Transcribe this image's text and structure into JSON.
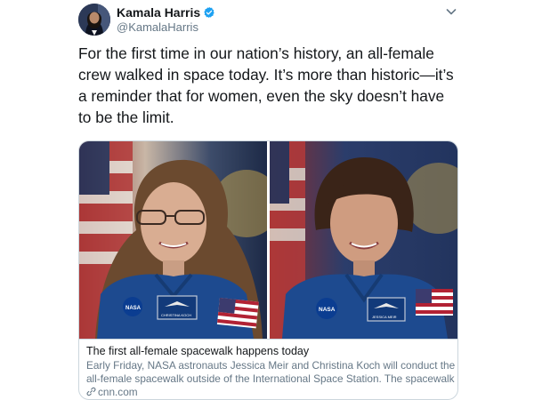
{
  "author": {
    "name": "Kamala Harris",
    "handle": "@KamalaHarris",
    "verified": true
  },
  "tweet": {
    "lines": [
      "For the first time in our nation’s history, an all-female",
      "crew walked in space today. It’s more than historic—it’s",
      "a reminder that for women, even the sky doesn’t have",
      "to be the limit."
    ]
  },
  "card": {
    "title": "The first all-female spacewalk happens today",
    "description_lines": [
      "Early Friday, NASA astronauts Jessica Meir and Christina Koch will conduct the first",
      "all-female spacewalk outside of the International Space Station. The spacewalk ..."
    ],
    "link": "cnn.com",
    "left_patch_text": "CHRISTINA KOCH",
    "right_patch_text": "JESSICA MEIR",
    "nasa_logo_text": "NASA"
  },
  "icons": {
    "verified": "verified-badge-icon",
    "menu": "chevron-down-icon",
    "link": "link-icon"
  },
  "colors": {
    "verified": "#1da1f2",
    "muted": "#657786",
    "border": "#ccd6dd",
    "suit": "#1d4a8f"
  }
}
